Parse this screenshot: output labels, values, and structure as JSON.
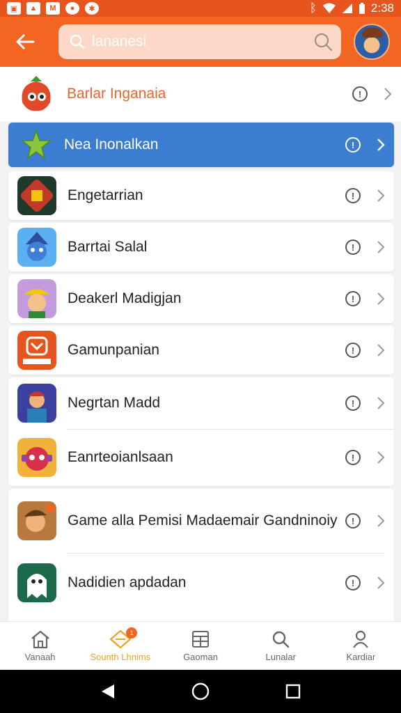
{
  "status_bar": {
    "time": "2:38",
    "notification_icons": [
      "gallery-icon",
      "image-icon",
      "mail-icon",
      "record-icon",
      "settings-icon"
    ]
  },
  "header": {
    "search_placeholder": "lananesi",
    "back_icon": "arrow-left-icon",
    "search_icon": "magnifier-icon",
    "accent_color": "#f26522"
  },
  "list": {
    "items": [
      {
        "title": "Barlar Inganaia",
        "icon": "strawberry-character-icon"
      },
      {
        "title": "Nea Inonalkan",
        "icon": "green-star-icon"
      },
      {
        "title": "Engetarrian",
        "icon": "game-controller-icon"
      },
      {
        "title": "Barrtai Salal",
        "icon": "blue-wizard-icon"
      },
      {
        "title": "Deakerl Madigjan",
        "icon": "yellow-hat-character-icon"
      },
      {
        "title": "Gamunpanian",
        "icon": "red-badge-icon"
      },
      {
        "title": "Negrtan Madd",
        "icon": "armored-hero-icon"
      },
      {
        "title": "Eanrteoianlsaan",
        "icon": "red-mask-icon"
      },
      {
        "title": "Game alla Pemisi Madaemair Gandninoiy",
        "icon": "warrior-icon"
      },
      {
        "title": "Nadidien apdadan",
        "icon": "white-ghost-icon"
      }
    ],
    "selected_color": "#3b7dd0"
  },
  "bottom_nav": {
    "items": [
      {
        "label": "Vanaah",
        "icon": "home-icon"
      },
      {
        "label": "Sounth Lhnims",
        "icon": "diamond-icon",
        "badge": "1"
      },
      {
        "label": "Gaoman",
        "icon": "grid-icon"
      },
      {
        "label": "Lunalar",
        "icon": "search-icon"
      },
      {
        "label": "Kardiar",
        "icon": "profile-icon"
      }
    ],
    "active_color": "#f0a020"
  }
}
